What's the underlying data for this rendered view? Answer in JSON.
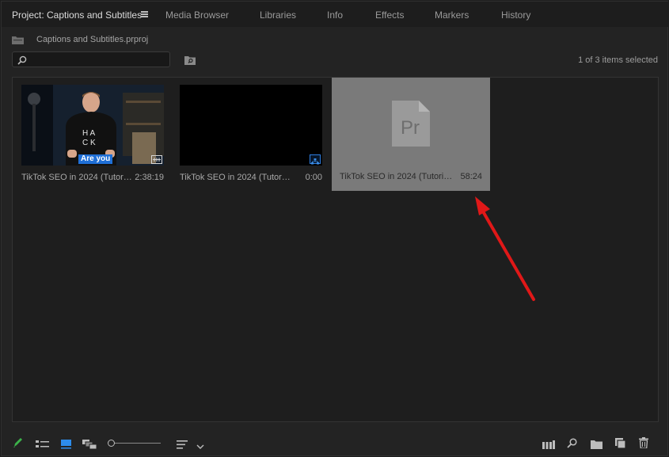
{
  "tabs": [
    {
      "label": "Project: Captions and Subtitles",
      "active": true
    },
    {
      "label": "Media Browser"
    },
    {
      "label": "Libraries"
    },
    {
      "label": "Info"
    },
    {
      "label": "Effects"
    },
    {
      "label": "Markers"
    },
    {
      "label": "History"
    }
  ],
  "project": {
    "filename": "Captions and Subtitles.prproj"
  },
  "search": {
    "value": "",
    "placeholder": ""
  },
  "status": {
    "items_selected": "1 of 3 items selected"
  },
  "bin": {
    "items": [
      {
        "name": "TikTok SEO in 2024 (Tutorial)",
        "duration": "2:38:19",
        "thumb_letters": "HACK",
        "caption_text": "Are you"
      },
      {
        "name": "TikTok SEO in 2024 (Tutorial)",
        "duration": "0:00"
      },
      {
        "name": "TikTok SEO in 2024 (Tutoria...",
        "duration": "58:24",
        "selected": true,
        "file_icon_text": "Pr"
      }
    ]
  },
  "toolbar": {
    "icons": [
      "pencil-icon",
      "list-view-icon",
      "icon-view-icon",
      "freeform-view-icon",
      "zoom-slider",
      "sort-icon",
      "chevron-down-icon",
      "automate-to-sequence-icon",
      "find-icon",
      "new-bin-icon",
      "new-item-icon",
      "trash-icon"
    ]
  },
  "colors": {
    "accent": "#2d8ceb",
    "selected_tile": "#7a7a7a",
    "annotation_arrow": "#e01818",
    "pencil": "#3cb34a"
  }
}
